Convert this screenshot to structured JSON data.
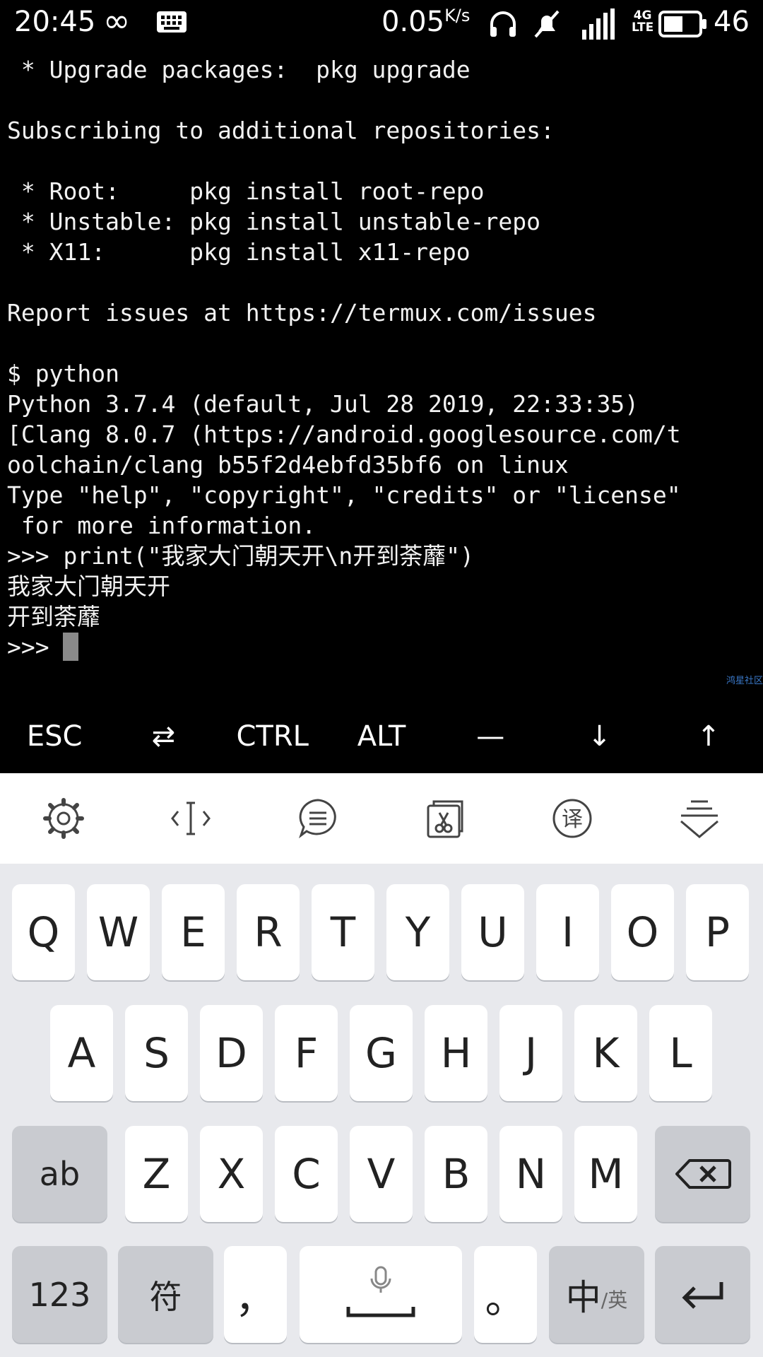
{
  "status_bar": {
    "time": "20:45",
    "net_speed": "0.05",
    "net_unit": "K/s",
    "network_type": "4G",
    "network_sub": "LTE",
    "battery_percent": "46"
  },
  "terminal": {
    "lines": [
      " * Upgrade packages:  pkg upgrade",
      "",
      "Subscribing to additional repositories:",
      "",
      " * Root:     pkg install root-repo",
      " * Unstable: pkg install unstable-repo",
      " * X11:      pkg install x11-repo",
      "",
      "Report issues at https://termux.com/issues",
      "",
      "$ python",
      "Python 3.7.4 (default, Jul 28 2019, 22:33:35)",
      "[Clang 8.0.7 (https://android.googlesource.com/t",
      "oolchain/clang b55f2d4ebfd35bf6 on linux",
      "Type \"help\", \"copyright\", \"credits\" or \"license\"",
      " for more information.",
      ">>> print(\"我家大门朝天开\\n开到荼蘼\")",
      "我家大门朝天开",
      "开到荼蘼"
    ],
    "prompt": ">>> ",
    "watermark": "鸿星社区"
  },
  "extra_keys": [
    "ESC",
    "⇄",
    "CTRL",
    "ALT",
    "—",
    "↓",
    "↑"
  ],
  "ime_toolbar": [
    {
      "icon": "gear-icon"
    },
    {
      "icon": "cursor-move-icon"
    },
    {
      "icon": "chat-bubble-icon"
    },
    {
      "icon": "clipboard-scissors-icon"
    },
    {
      "icon": "translate-icon"
    },
    {
      "icon": "collapse-keyboard-icon"
    }
  ],
  "keyboard": {
    "row1": [
      "Q",
      "W",
      "E",
      "R",
      "T",
      "Y",
      "U",
      "I",
      "O",
      "P"
    ],
    "row2": [
      "A",
      "S",
      "D",
      "F",
      "G",
      "H",
      "J",
      "K",
      "L"
    ],
    "row3": [
      "Z",
      "X",
      "C",
      "V",
      "B",
      "N",
      "M"
    ],
    "shift_label": "ab",
    "numbers_label": "123",
    "symbols_label": "符",
    "comma_label": "，",
    "period_label": "。",
    "lang_label": "中",
    "lang_sub_label": "/英"
  }
}
